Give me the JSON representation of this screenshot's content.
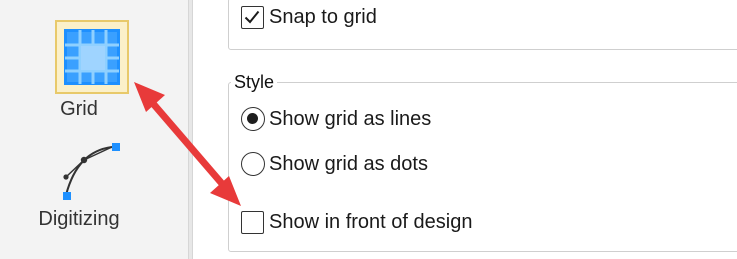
{
  "sidebar": {
    "items": [
      {
        "label": "Grid",
        "icon": "grid-icon"
      },
      {
        "label": "Digitizing",
        "icon": "bezier-curve-icon"
      }
    ]
  },
  "snap": {
    "label": "Snap to grid",
    "checked": true
  },
  "style_group": {
    "legend": "Style",
    "options": [
      {
        "label": "Show grid as lines",
        "selected": true
      },
      {
        "label": "Show grid as dots",
        "selected": false
      }
    ]
  },
  "front": {
    "label": "Show in front of design",
    "checked": false
  },
  "colors": {
    "grid_icon_blue": "#1e90ff",
    "grid_icon_frame": "#e8c96a",
    "annotation_arrow": "#e83a3a",
    "handle_blue": "#1e90ff"
  }
}
